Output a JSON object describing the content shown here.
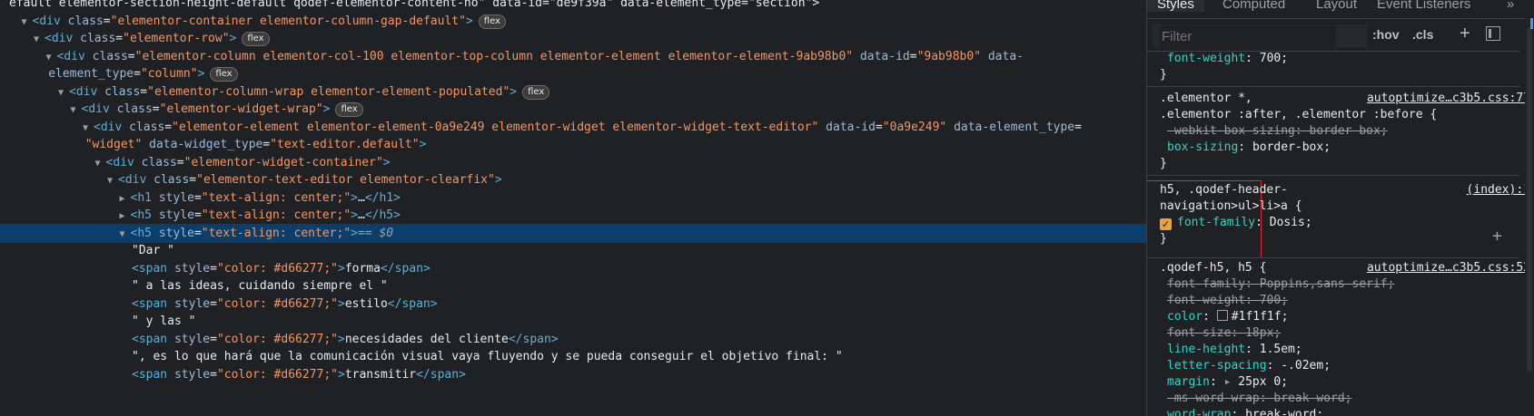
{
  "dom_rows": [
    {
      "indent": 0,
      "type": "text",
      "text": "efault elementor-section-height-default qodef-elementor-content-no\" data-id=\"de9f39a\" data-element_type=\"section\">"
    },
    {
      "indent": 1,
      "type": "open",
      "tri": "▼",
      "tag": "div",
      "attrs": [
        {
          "n": "class",
          "v": "elementor-container elementor-column-gap-default"
        }
      ],
      "badge": "flex"
    },
    {
      "indent": 2,
      "type": "open",
      "tri": "▼",
      "tag": "div",
      "attrs": [
        {
          "n": "class",
          "v": "elementor-row"
        }
      ],
      "badge": "flex"
    },
    {
      "indent": 3,
      "type": "open",
      "tri": "▼",
      "tag": "div",
      "attrs": [
        {
          "n": "class",
          "v": "elementor-column elementor-col-100 elementor-top-column elementor-element elementor-element-9ab98b0"
        },
        {
          "n": "data-id",
          "v": "9ab98b0"
        },
        {
          "n": "data-",
          "v": null
        }
      ],
      "badge": ""
    },
    {
      "indent": 3.2,
      "type": "cont",
      "parts": [
        {
          "c": "an",
          "t": "element_type"
        },
        {
          "c": "tx",
          "t": "="
        },
        {
          "c": "av",
          "t": "\"column\""
        },
        {
          "c": "tag",
          "t": ">"
        }
      ],
      "badge": "flex"
    },
    {
      "indent": 4,
      "type": "open",
      "tri": "▼",
      "tag": "div",
      "attrs": [
        {
          "n": "class",
          "v": "elementor-column-wrap elementor-element-populated"
        }
      ],
      "badge": "flex"
    },
    {
      "indent": 5,
      "type": "open",
      "tri": "▼",
      "tag": "div",
      "attrs": [
        {
          "n": "class",
          "v": "elementor-widget-wrap"
        }
      ],
      "badge": "flex"
    },
    {
      "indent": 6,
      "type": "open",
      "tri": "▼",
      "tag": "div",
      "attrs": [
        {
          "n": "class",
          "v": "elementor-element elementor-element-0a9e249 elementor-widget elementor-widget-text-editor"
        },
        {
          "n": "data-id",
          "v": "0a9e249"
        },
        {
          "n": "data-element_type",
          "v": "="
        }
      ],
      "badge": ""
    },
    {
      "indent": 6.2,
      "type": "cont",
      "parts": [
        {
          "c": "av",
          "t": "\"widget\""
        },
        {
          "c": "tx",
          "t": " "
        },
        {
          "c": "an",
          "t": "data-widget_type"
        },
        {
          "c": "tx",
          "t": "="
        },
        {
          "c": "av",
          "t": "\"text-editor.default\""
        },
        {
          "c": "tag",
          "t": ">"
        }
      ],
      "badge": ""
    },
    {
      "indent": 7,
      "type": "open",
      "tri": "▼",
      "tag": "div",
      "attrs": [
        {
          "n": "class",
          "v": "elementor-widget-container"
        }
      ],
      "badge": ""
    },
    {
      "indent": 8,
      "type": "open",
      "tri": "▼",
      "tag": "div",
      "attrs": [
        {
          "n": "class",
          "v": "elementor-text-editor elementor-clearfix"
        }
      ],
      "badge": ""
    },
    {
      "indent": 9,
      "type": "collapsed",
      "tri": "▶",
      "tag": "h1",
      "attrs": [
        {
          "n": "style",
          "v": "text-align: center;"
        }
      ],
      "close": "h1"
    },
    {
      "indent": 9,
      "type": "collapsed",
      "tri": "▶",
      "tag": "h5",
      "attrs": [
        {
          "n": "style",
          "v": "text-align: center;"
        }
      ],
      "close": "h5"
    },
    {
      "indent": 9,
      "type": "selected",
      "tri": "▼",
      "tag": "h5",
      "attrs": [
        {
          "n": "style",
          "v": "text-align: center;"
        }
      ],
      "eq": "== $0"
    },
    {
      "indent": 10,
      "type": "text",
      "text": "\"Dar \""
    },
    {
      "indent": 10,
      "type": "span",
      "style": "color: #d66277;",
      "inner": "forma"
    },
    {
      "indent": 10,
      "type": "text",
      "text": "\" a las ideas, cuidando siempre el \""
    },
    {
      "indent": 10,
      "type": "span",
      "style": "color: #d66277;",
      "inner": "estilo"
    },
    {
      "indent": 10,
      "type": "text",
      "text": "\" y las \""
    },
    {
      "indent": 10,
      "type": "span",
      "style": "color: #d66277;",
      "inner": "necesidades del cliente"
    },
    {
      "indent": 10,
      "type": "text",
      "text": "\", es lo que hará que la comunicación visual vaya fluyendo y se pueda conseguir el objetivo final: \""
    },
    {
      "indent": 10,
      "type": "span",
      "style": "color: #d66277;",
      "inner": "transmitir"
    }
  ],
  "tabs": {
    "styles": "Styles",
    "computed": "Computed",
    "layout": "Layout",
    "listeners": "Event Listeners",
    "more": "»"
  },
  "filter": {
    "placeholder": "Filter",
    "hov": ":hov",
    "cls": ".cls",
    "plus": "+"
  },
  "rules": {
    "r0": {
      "prop": "font-weight",
      "val": "700;",
      "close": "}"
    },
    "r1": {
      "sel1": ".elementor *,",
      "sel2": ".elementor :after, .elementor :before {",
      "src": "autoptimize…c3b5.css:77",
      "p1": "-webkit-box-sizing",
      "v1": "border-box;",
      "p2": "box-sizing",
      "v2": "border-box;",
      "close": "}"
    },
    "r2": {
      "sel1": "h5, .qodef-header-",
      "sel2": "navigation>ul>li>a {",
      "src": "(index):1",
      "p1": "font-family",
      "v1": "Dosis;",
      "close": "}",
      "add": "+"
    },
    "r3": {
      "sel1": ".qodef-h5, h5 {",
      "src": "autoptimize…c3b5.css:52",
      "props": [
        {
          "p": "font-family",
          "v": "Poppins,sans-serif;",
          "strike": true
        },
        {
          "p": "font-weight",
          "v": "700;",
          "strike": true
        },
        {
          "p": "color",
          "v": "#1f1f1f;",
          "strike": false,
          "swatch": true
        },
        {
          "p": "font-size",
          "v": "18px;",
          "strike": true
        },
        {
          "p": "line-height",
          "v": "1.5em;",
          "strike": false
        },
        {
          "p": "letter-spacing",
          "v": "-.02em;",
          "strike": false
        },
        {
          "p": "margin",
          "v": "25px 0;",
          "strike": false,
          "arrow": true
        },
        {
          "p": "-ms-word-wrap",
          "v": "break-word;",
          "strike": true
        },
        {
          "p": "word-wrap",
          "v": "break-word;",
          "strike": false
        }
      ]
    }
  }
}
